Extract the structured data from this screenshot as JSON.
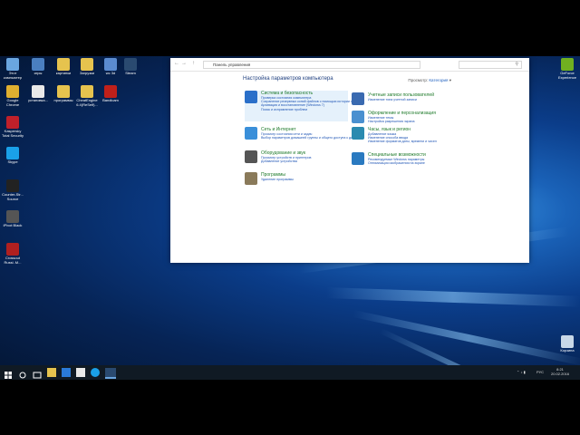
{
  "desktop": {
    "icons": [
      {
        "label": "Этот компьютер",
        "color": "#6aa6e0"
      },
      {
        "label": "игры",
        "color": "#4a7fc0"
      },
      {
        "label": "картинки",
        "color": "#e6c34e"
      },
      {
        "label": "Загрузки",
        "color": "#e6c34e"
      },
      {
        "label": "wc 3d",
        "color": "#5a8bd0"
      },
      {
        "label": "Steam",
        "color": "#2a4a70"
      },
      {
        "label": "Google Chrome",
        "color": "#e0b030"
      },
      {
        "label": "установка...",
        "color": "#e9e9e9"
      },
      {
        "label": "программы",
        "color": "#e6c34e"
      },
      {
        "label": "CheatEngine 6.4(ReSelf)...",
        "color": "#e6c34e"
      },
      {
        "label": "Bandicam",
        "color": "#c0201a"
      },
      {
        "label": "Kaspersky Total Security",
        "color": "#c0202a"
      },
      {
        "label": "Skype",
        "color": "#1aa0e8"
      },
      {
        "label": "Counter-Str... Source",
        "color": "#222222"
      },
      {
        "label": "iPivot Black",
        "color": "#555555"
      },
      {
        "label": "Crossout Russi..M...",
        "color": "#b02020"
      },
      {
        "label": "GeForce Experience",
        "color": "#70b020"
      },
      {
        "label": "Корзина",
        "color": "#c8d8e8"
      }
    ]
  },
  "window": {
    "breadcrumb": "Панель управления",
    "heading": "Настройка параметров компьютера",
    "view_label": "Просмотр:",
    "view_value": "Категория",
    "categories": [
      {
        "title": "Система и безопасность",
        "icon_color": "#2a6fc9",
        "links": [
          "Проверка состояния компьютера",
          "Сохранение резервных копий файлов с помощью истории файлов",
          "Архивация и восстановление (Windows 7)",
          "Поиск и исправление проблем"
        ]
      },
      {
        "title": "Сеть и Интернет",
        "icon_color": "#3a8fd9",
        "links": [
          "Просмотр состояния сети и задач",
          "Выбор параметров домашней группы и общего доступа к данным"
        ]
      },
      {
        "title": "Оборудование и звук",
        "icon_color": "#555555",
        "links": [
          "Просмотр устройств и принтеров",
          "Добавление устройства"
        ]
      },
      {
        "title": "Программы",
        "icon_color": "#8a7a5a",
        "links": [
          "Удаление программы"
        ]
      },
      {
        "title": "Учетные записи пользователей",
        "icon_color": "#3a6ab0",
        "links": [
          "Изменение типа учетной записи"
        ]
      },
      {
        "title": "Оформление и персонализация",
        "icon_color": "#4a90d0",
        "links": [
          "Изменение темы",
          "Настройка разрешения экрана"
        ]
      },
      {
        "title": "Часы, язык и регион",
        "icon_color": "#2a8ab0",
        "links": [
          "Добавление языка",
          "Изменение способа ввода",
          "Изменение форматов даты, времени и чисел"
        ]
      },
      {
        "title": "Специальные возможности",
        "icon_color": "#2a7ac0",
        "links": [
          "Рекомендуемые Windows параметры",
          "Оптимизация изображения на экране"
        ]
      }
    ]
  },
  "taskbar": {
    "lang": "РУС",
    "time": "8:21",
    "date": "20.02.2016"
  }
}
